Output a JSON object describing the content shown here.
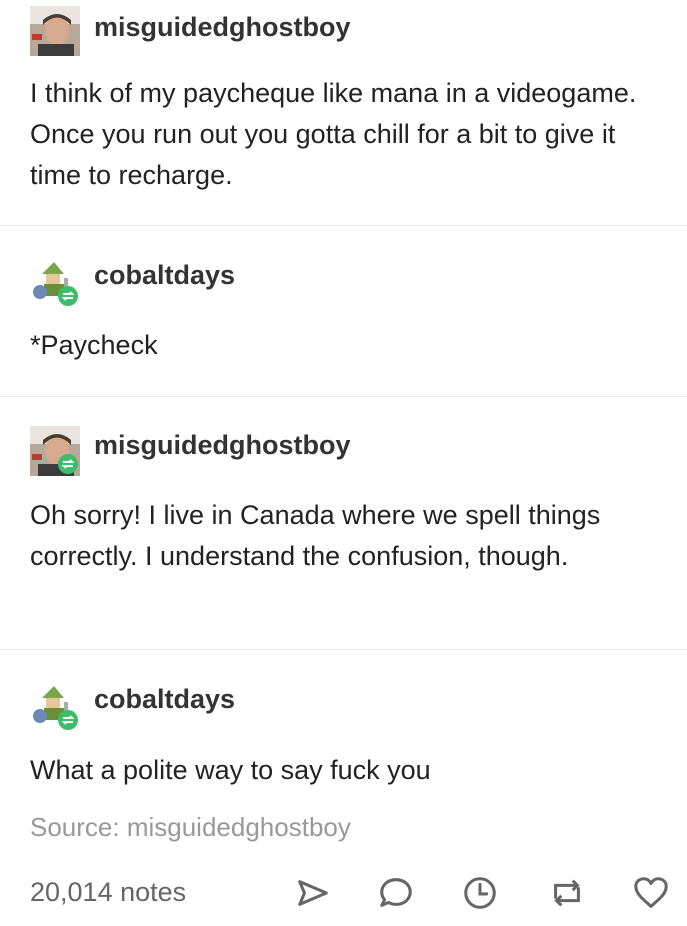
{
  "posts": [
    {
      "username": "misguidedghostboy",
      "text": "I think of my paycheque like mana in a videogame. Once you run out you gotta chill for a bit to give it time to recharge."
    },
    {
      "username": "cobaltdays",
      "text": "*Paycheck"
    },
    {
      "username": "misguidedghostboy",
      "text": "Oh sorry! I live in Canada where we spell things correctly. I understand the confusion, though."
    },
    {
      "username": "cobaltdays",
      "text": "What a polite way to say fuck you"
    }
  ],
  "source": "Source: misguidedghostboy",
  "notes": "20,014 notes",
  "actions": [
    "share-icon",
    "reply-icon",
    "schedule-icon",
    "reblog-icon",
    "heart-icon"
  ],
  "colors": {
    "reblog_badge": "#3ebd6b",
    "muted_text": "#999999",
    "icon": "#666666"
  }
}
